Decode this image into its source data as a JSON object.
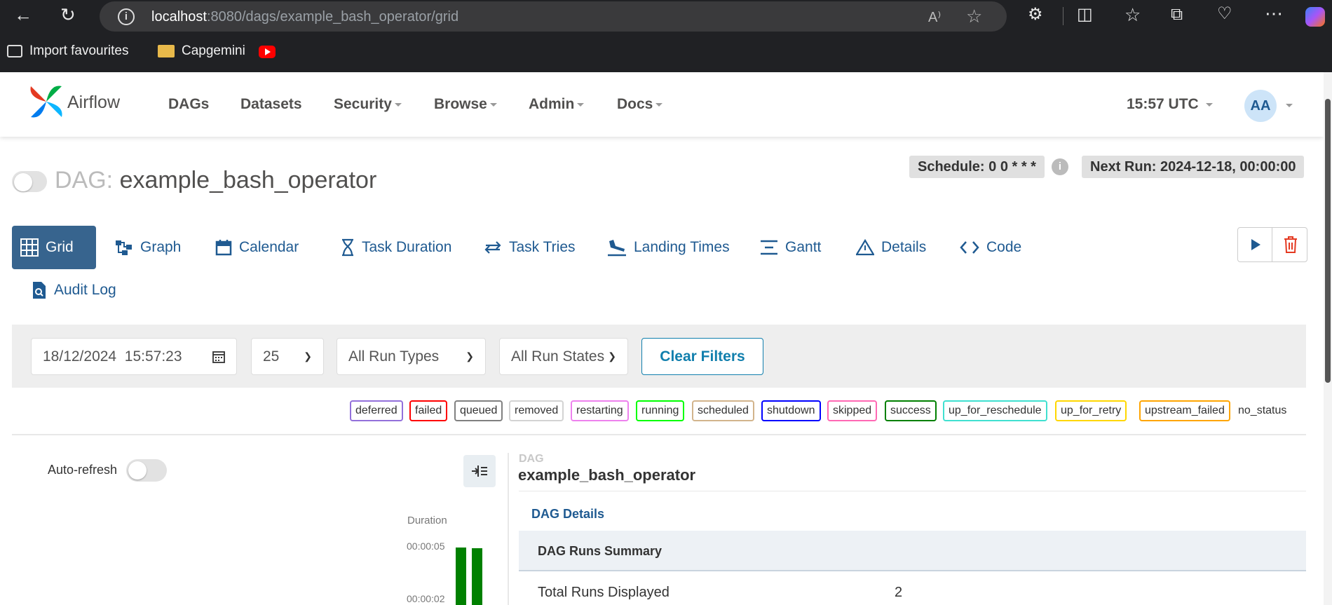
{
  "browser": {
    "url_host": "localhost",
    "url_path": ":8080/dags/example_bash_operator/grid",
    "read_aloud_label": "A⁾",
    "favourites": [
      {
        "label": "Import favourites"
      },
      {
        "label": "Capgemini"
      }
    ]
  },
  "navbar": {
    "brand": "Airflow",
    "items": [
      {
        "label": "DAGs"
      },
      {
        "label": "Datasets"
      },
      {
        "label": "Security"
      },
      {
        "label": "Browse"
      },
      {
        "label": "Admin"
      },
      {
        "label": "Docs"
      }
    ],
    "clock": "15:57 UTC",
    "user_initials": "AA"
  },
  "dag": {
    "prefix": "DAG:",
    "name": "example_bash_operator",
    "schedule": "Schedule: 0 0 * * *",
    "next_run": "Next Run: 2024-12-18, 00:00:00"
  },
  "tabs": [
    {
      "label": "Grid",
      "icon": "grid-icon"
    },
    {
      "label": "Graph",
      "icon": "graph-icon"
    },
    {
      "label": "Calendar",
      "icon": "calendar-icon"
    },
    {
      "label": "Task Duration",
      "icon": "hourglass-icon"
    },
    {
      "label": "Task Tries",
      "icon": "retry-icon"
    },
    {
      "label": "Landing Times",
      "icon": "plane-landing-icon"
    },
    {
      "label": "Gantt",
      "icon": "gantt-icon"
    },
    {
      "label": "Details",
      "icon": "warning-triangle-icon"
    },
    {
      "label": "Code",
      "icon": "code-icon"
    },
    {
      "label": "Audit Log",
      "icon": "audit-log-icon"
    }
  ],
  "filters": {
    "date_value": "18/12/2024  15:57:23",
    "num_runs": "25",
    "run_types": "All Run Types",
    "run_states": "All Run States",
    "clear_label": "Clear Filters"
  },
  "states": [
    {
      "label": "deferred",
      "color": "#9370db"
    },
    {
      "label": "failed",
      "color": "#ff0000"
    },
    {
      "label": "queued",
      "color": "#808080"
    },
    {
      "label": "removed",
      "color": "#d3d3d3"
    },
    {
      "label": "restarting",
      "color": "#ee82ee"
    },
    {
      "label": "running",
      "color": "#00ff00"
    },
    {
      "label": "scheduled",
      "color": "#d2b48c"
    },
    {
      "label": "shutdown",
      "color": "#0000ff"
    },
    {
      "label": "skipped",
      "color": "#ff69b4"
    },
    {
      "label": "success",
      "color": "#008000"
    },
    {
      "label": "up_for_reschedule",
      "color": "#40e0d0"
    },
    {
      "label": "up_for_retry",
      "color": "#ffd700"
    },
    {
      "label": "upstream_failed",
      "color": "#ffa500"
    },
    {
      "label": "no_status",
      "color": ""
    }
  ],
  "grid": {
    "auto_refresh_label": "Auto-refresh",
    "duration_label": "Duration",
    "duration_ticks": [
      "00:00:05",
      "00:00:02"
    ],
    "bar_color": "#008000"
  },
  "details": {
    "kind_label": "DAG",
    "dag_name": "example_bash_operator",
    "tab_label": "DAG Details",
    "summary_header": "DAG Runs Summary",
    "rows": [
      {
        "label": "Total Runs Displayed",
        "value": "2"
      }
    ]
  }
}
